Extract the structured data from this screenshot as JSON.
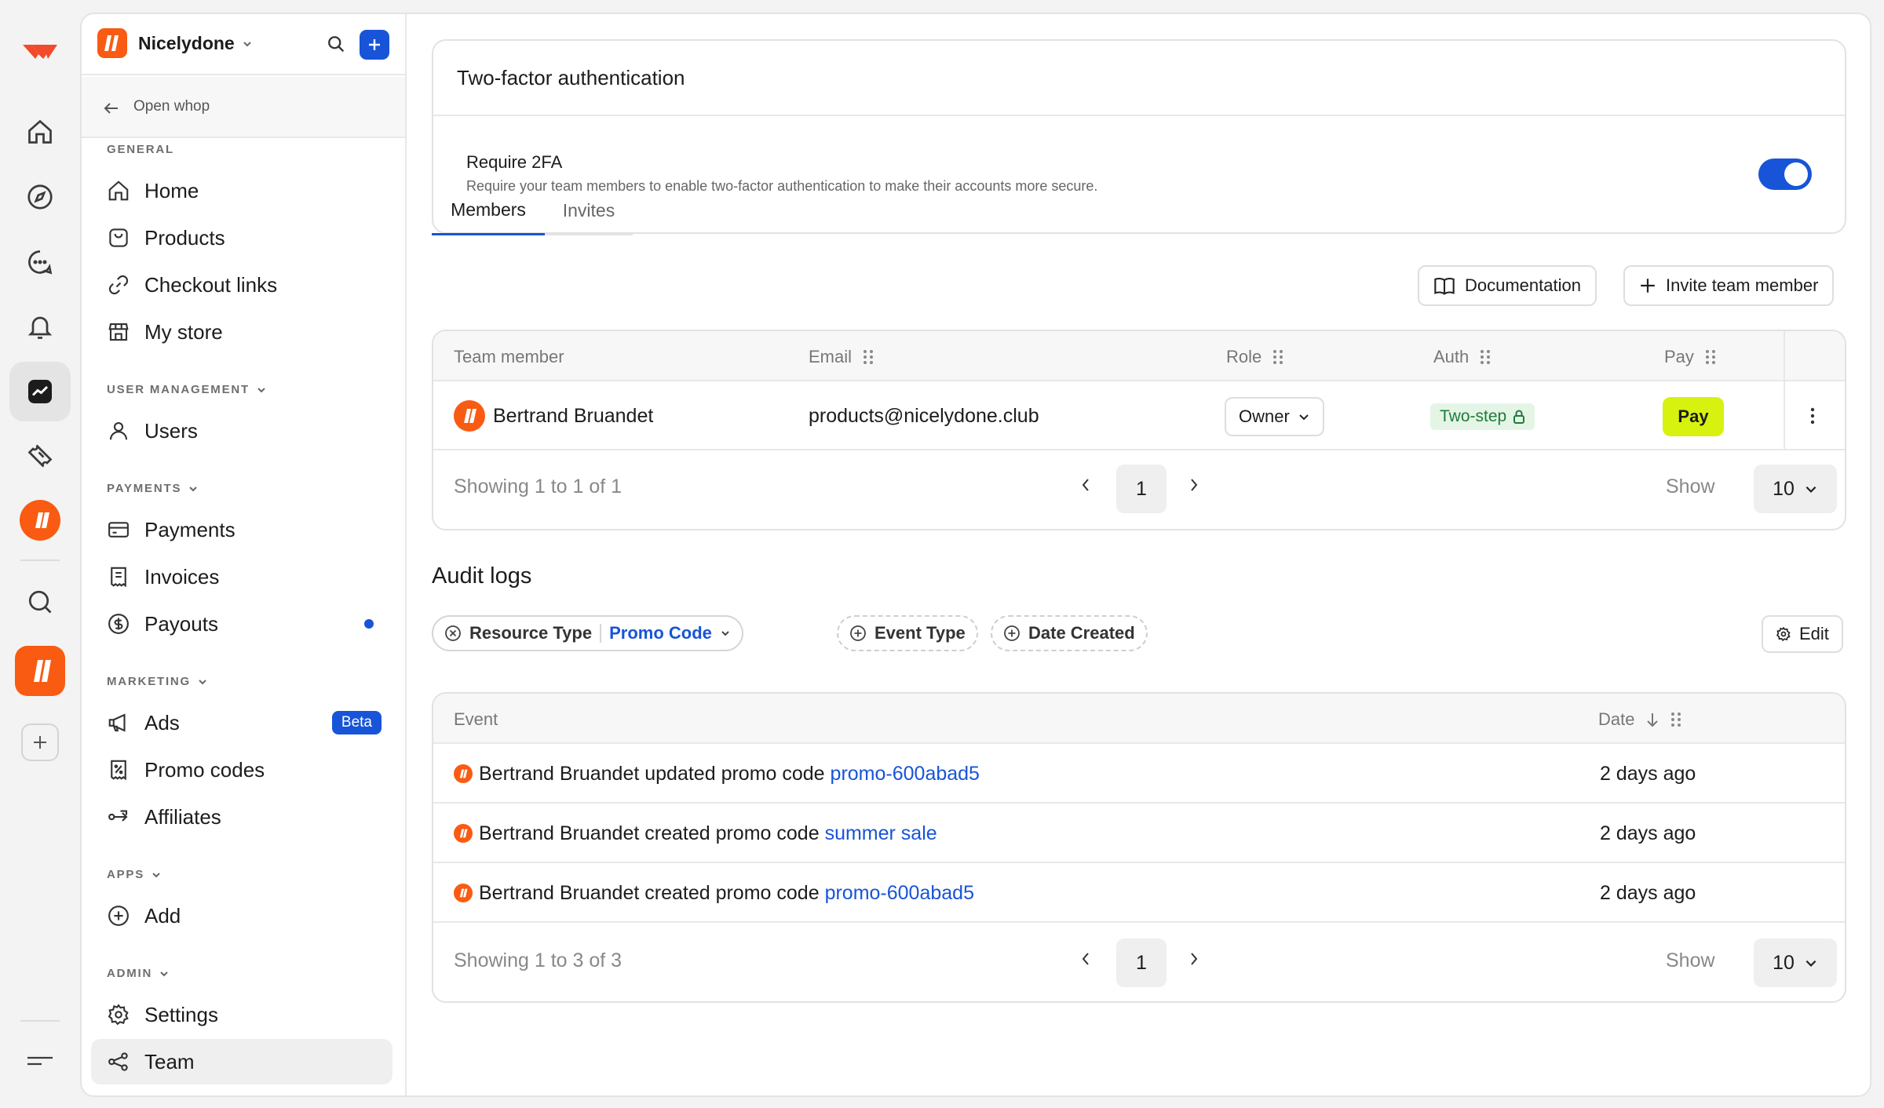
{
  "sidebar": {
    "workspace_name": "Nicelydone",
    "open_whop": "Open whop",
    "sections": {
      "general": "GENERAL",
      "user_management": "USER MANAGEMENT",
      "payments": "PAYMENTS",
      "marketing": "MARKETING",
      "apps": "APPS",
      "admin": "ADMIN"
    },
    "items": {
      "home": "Home",
      "products": "Products",
      "checkout_links": "Checkout links",
      "my_store": "My store",
      "users": "Users",
      "payments": "Payments",
      "invoices": "Invoices",
      "payouts": "Payouts",
      "ads": "Ads",
      "ads_badge": "Beta",
      "promo_codes": "Promo codes",
      "affiliates": "Affiliates",
      "add": "Add",
      "settings": "Settings",
      "team": "Team"
    }
  },
  "twofa": {
    "title": "Two-factor authentication",
    "label": "Require 2FA",
    "description": "Require your team members to enable two-factor authentication to make their accounts more secure.",
    "enabled": true
  },
  "tabs": {
    "members": "Members",
    "invites": "Invites"
  },
  "actions": {
    "documentation": "Documentation",
    "invite": "Invite team member"
  },
  "members_table": {
    "headers": {
      "member": "Team member",
      "email": "Email",
      "role": "Role",
      "auth": "Auth",
      "pay": "Pay"
    },
    "row": {
      "name": "Bertrand Bruandet",
      "email": "products@nicelydone.club",
      "role": "Owner",
      "auth": "Two-step",
      "pay": "Pay"
    },
    "showing": "Showing 1 to 1 of 1",
    "page": "1",
    "show_label": "Show",
    "page_size": "10"
  },
  "audit": {
    "title": "Audit logs",
    "filters": {
      "resource_type": "Resource Type",
      "resource_value": "Promo Code",
      "event_type": "Event Type",
      "date_created": "Date Created"
    },
    "edit": "Edit",
    "headers": {
      "event": "Event",
      "date": "Date"
    },
    "rows": [
      {
        "actor": "Bertrand Bruandet",
        "action": "updated promo code",
        "target": "promo-600abad5",
        "date": "2 days ago"
      },
      {
        "actor": "Bertrand Bruandet",
        "action": "created promo code",
        "target": "summer sale",
        "date": "2 days ago"
      },
      {
        "actor": "Bertrand Bruandet",
        "action": "created promo code",
        "target": "promo-600abad5",
        "date": "2 days ago"
      }
    ],
    "showing": "Showing 1 to 3 of 3",
    "page": "1",
    "show_label": "Show",
    "page_size": "10"
  },
  "colors": {
    "accent": "#1754d8",
    "brand": "#fa5b12",
    "pay": "#d7f20f",
    "auth_bg": "#e4f5e6",
    "auth_text": "#1f7a3a"
  }
}
